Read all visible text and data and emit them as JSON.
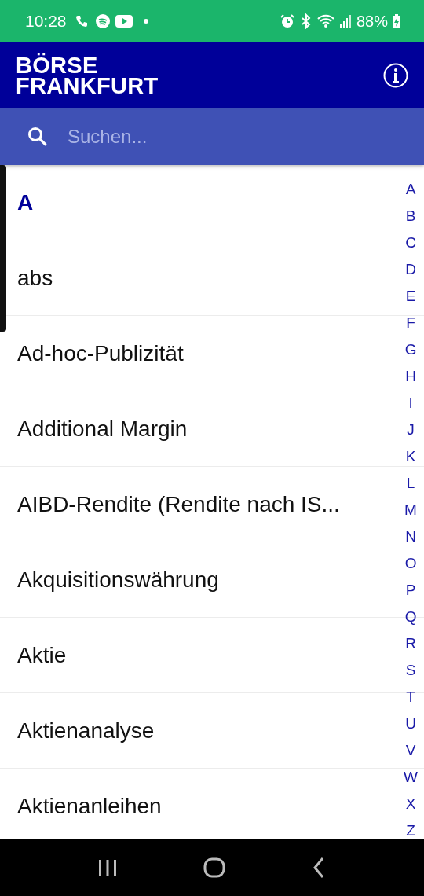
{
  "status_bar": {
    "time": "10:28",
    "battery": "88%"
  },
  "header": {
    "logo_lines": [
      "BÖRSE",
      "FRANKFURT"
    ]
  },
  "search": {
    "placeholder": "Suchen..."
  },
  "list": {
    "section": "A",
    "items": [
      "abs",
      "Ad-hoc-Publizität",
      "Additional Margin",
      "AIBD-Rendite (Rendite nach IS...",
      "Akquisitionswährung",
      "Aktie",
      "Aktienanalyse",
      "Aktienanleihen"
    ]
  },
  "index": [
    "A",
    "B",
    "C",
    "D",
    "E",
    "F",
    "G",
    "H",
    "I",
    "J",
    "K",
    "L",
    "M",
    "N",
    "O",
    "P",
    "Q",
    "R",
    "S",
    "T",
    "U",
    "V",
    "W",
    "X",
    "Z"
  ]
}
